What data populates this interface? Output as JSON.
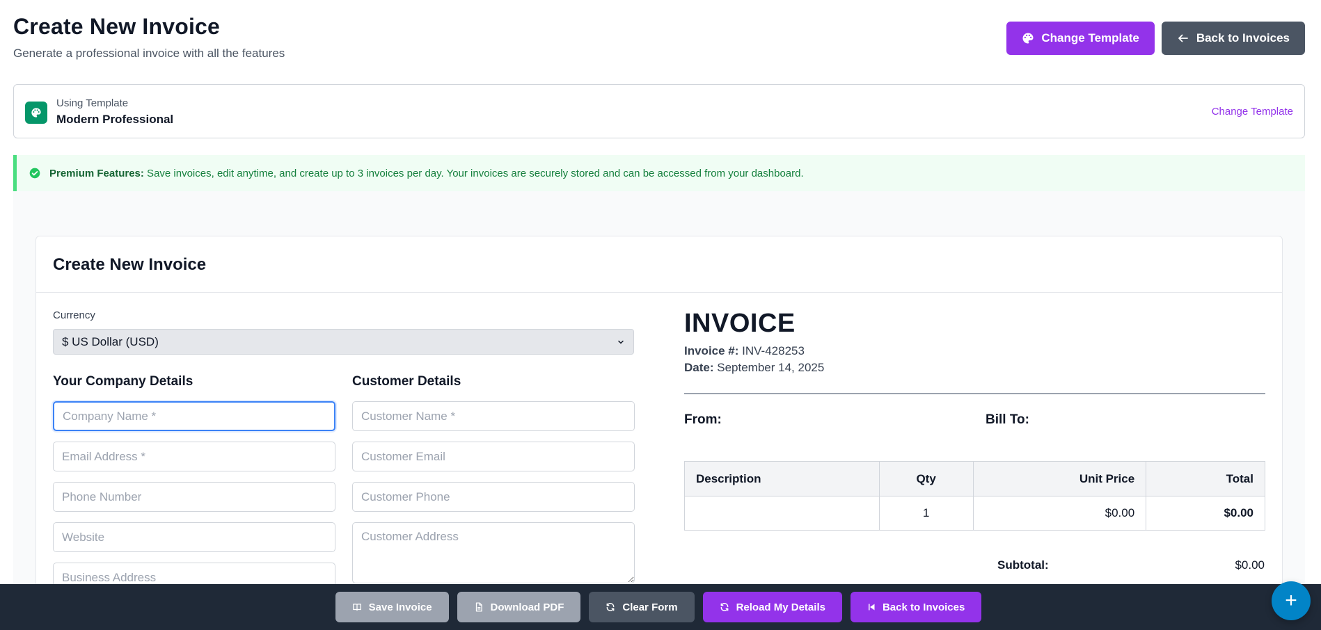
{
  "header": {
    "title": "Create New Invoice",
    "subtitle": "Generate a professional invoice with all the features",
    "change_template_label": "Change Template",
    "back_label": "Back to Invoices"
  },
  "template": {
    "label": "Using Template",
    "name": "Modern Professional",
    "change_link": "Change Template"
  },
  "premium": {
    "heading": "Premium Features:",
    "text": " Save invoices, edit anytime, and create up to 3 invoices per day. Your invoices are securely stored and can be accessed from your dashboard."
  },
  "form": {
    "title": "Create New Invoice",
    "currency_label": "Currency",
    "currency_value": "$ US Dollar (USD)",
    "company_section": "Your Company Details",
    "customer_section": "Customer Details",
    "company_name_placeholder": "Company Name *",
    "email_placeholder": "Email Address *",
    "phone_placeholder": "Phone Number",
    "website_placeholder": "Website",
    "business_address_placeholder": "Business Address",
    "customer_name_placeholder": "Customer Name *",
    "customer_email_placeholder": "Customer Email",
    "customer_phone_placeholder": "Customer Phone",
    "customer_address_placeholder": "Customer Address"
  },
  "preview": {
    "title": "INVOICE",
    "invoice_no_label": "Invoice #:",
    "invoice_no": "INV-428253",
    "date_label": "Date:",
    "date": "September 14, 2025",
    "from_label": "From:",
    "bill_to_label": "Bill To:",
    "table": {
      "headers": [
        "Description",
        "Qty",
        "Unit Price",
        "Total"
      ],
      "rows": [
        {
          "description": "",
          "qty": "1",
          "unit_price": "$0.00",
          "total": "$0.00"
        }
      ]
    },
    "subtotal_label": "Subtotal:",
    "subtotal_value": "$0.00"
  },
  "actions": {
    "save": "Save Invoice",
    "download": "Download PDF",
    "clear": "Clear Form",
    "reload": "Reload My Details",
    "back": "Back to Invoices"
  },
  "fab": {
    "label": "+"
  },
  "colors": {
    "purple": "#9333ea",
    "gray": "#4b5563",
    "green": "#059669",
    "banner_bg": "#f0fdf4",
    "footer_bg": "#1f2937",
    "fab_bg": "#0284c7"
  }
}
